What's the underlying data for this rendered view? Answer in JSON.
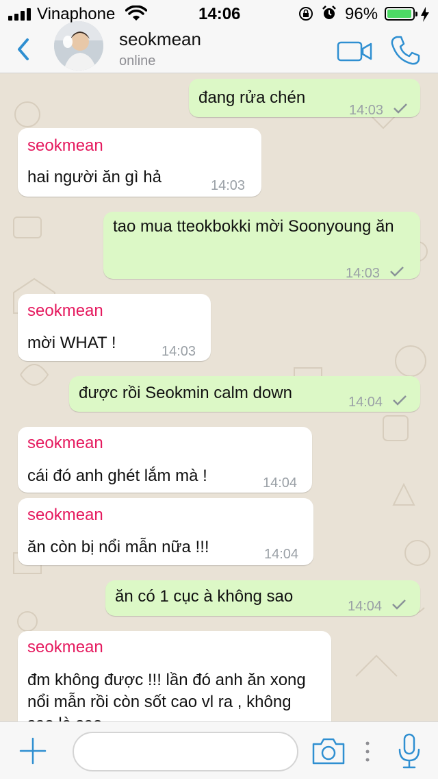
{
  "status_bar": {
    "carrier": "Vinaphone",
    "time": "14:06",
    "battery_percent": "96%",
    "battery_level": 0.96
  },
  "header": {
    "contact_name": "seokmean",
    "contact_status": "online"
  },
  "messages": [
    {
      "direction": "out",
      "text": "đang rửa chén",
      "time": "14:03"
    },
    {
      "direction": "in",
      "sender": "seokmean",
      "text": "hai người ăn gì hả",
      "time": "14:03"
    },
    {
      "direction": "out",
      "text": "tao mua tteokbokki mời Soonyoung ăn",
      "time": "14:03"
    },
    {
      "direction": "in",
      "sender": "seokmean",
      "text": "mời WHAT !",
      "time": "14:03"
    },
    {
      "direction": "out",
      "text": "được rồi Seokmin calm down",
      "time": "14:04"
    },
    {
      "direction": "in",
      "sender": "seokmean",
      "text": "cái đó anh ghét lắm mà !",
      "time": "14:04"
    },
    {
      "direction": "in",
      "sender": "seokmean",
      "text": "ăn còn bị nổi mẫn nữa !!!",
      "time": "14:04"
    },
    {
      "direction": "out",
      "text": "ăn có 1 cục à không sao",
      "time": "14:04"
    },
    {
      "direction": "in",
      "sender": "seokmean",
      "text": "đm không được !!! lần đó anh ăn xong nổi mẫn rồi còn sốt cao vl ra , không sao là sao"
    }
  ],
  "composer": {
    "value": "",
    "placeholder": ""
  },
  "colors": {
    "accent": "#2f8fd1",
    "sender_name": "#e5195e",
    "outgoing_bubble": "#dcf8c6",
    "incoming_bubble": "#ffffff",
    "wallpaper": "#e9e2d6"
  },
  "icons": {
    "back": "chevron-left-icon",
    "video": "video-camera-icon",
    "call": "phone-icon",
    "add": "plus-icon",
    "camera": "camera-icon",
    "mic": "microphone-icon"
  }
}
